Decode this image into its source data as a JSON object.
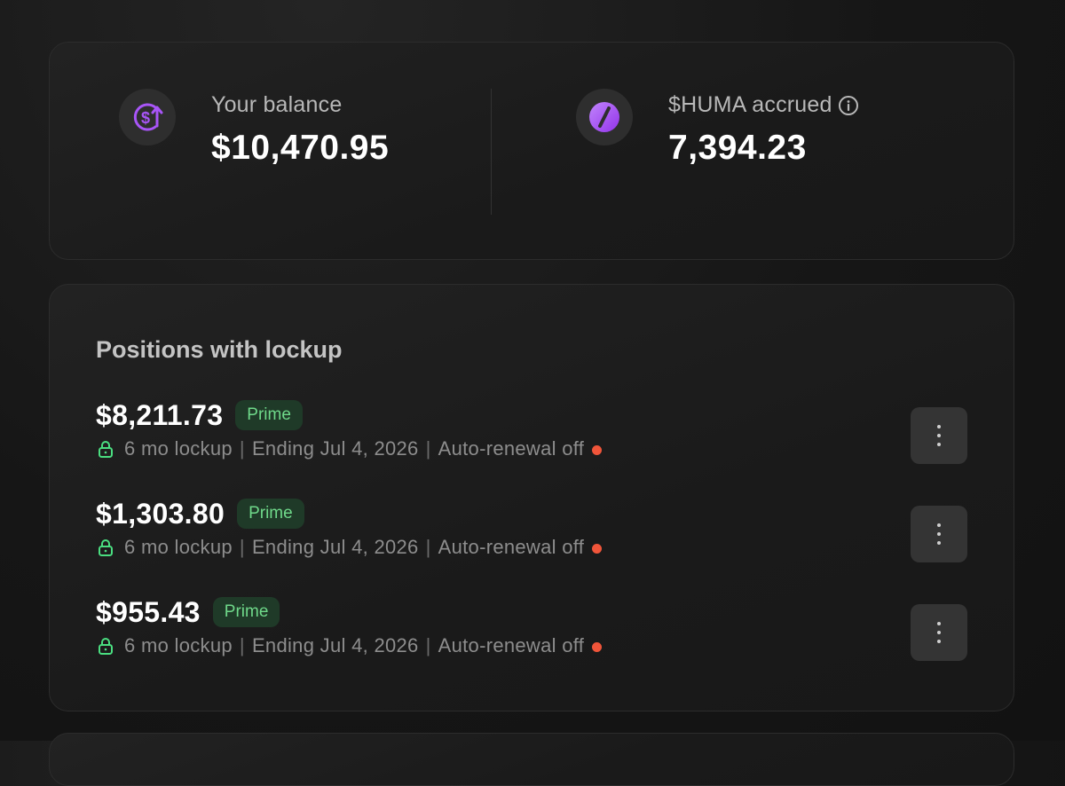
{
  "summary": {
    "balance": {
      "label": "Your balance",
      "value": "$10,470.95",
      "icon": "dollar-up-icon"
    },
    "huma": {
      "label": "$HUMA accrued",
      "value": "7,394.23",
      "icon": "huma-logo-icon",
      "info_icon": "info-icon"
    }
  },
  "positions": {
    "title": "Positions with lockup",
    "items": [
      {
        "amount": "$8,211.73",
        "badge": "Prime",
        "lockup": "6 mo lockup",
        "ending": "Ending Jul 4, 2026",
        "renewal": "Auto-renewal off"
      },
      {
        "amount": "$1,303.80",
        "badge": "Prime",
        "lockup": "6 mo lockup",
        "ending": "Ending Jul 4, 2026",
        "renewal": "Auto-renewal off"
      },
      {
        "amount": "$955.43",
        "badge": "Prime",
        "lockup": "6 mo lockup",
        "ending": "Ending Jul 4, 2026",
        "renewal": "Auto-renewal off"
      }
    ],
    "separator": "|"
  },
  "colors": {
    "accent_purple": "#a855f7",
    "badge_green": "#6fd98a",
    "badge_bg": "#1f3a28",
    "status_off": "#f0553a"
  }
}
